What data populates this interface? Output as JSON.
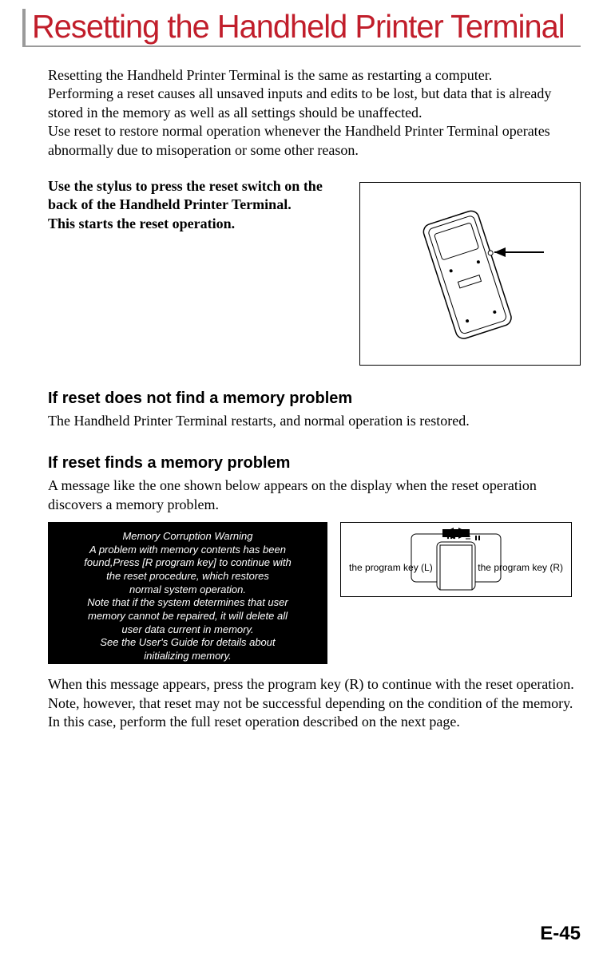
{
  "title": "Resetting the Handheld Printer Terminal",
  "intro": {
    "p1": "Resetting the Handheld Printer Terminal is the same as restarting a computer.",
    "p2": "Performing a reset causes all unsaved inputs and edits to be lost, but data that is already stored in the memory as well as all settings should be unaffected.",
    "p3": "Use reset to restore normal operation whenever the Handheld Printer Terminal operates abnormally due to misoperation or some other reason."
  },
  "instruction": {
    "l1": "Use the stylus to press the reset switch on the back of the Handheld Printer Terminal.",
    "l2": "This starts the reset operation."
  },
  "sec_no_problem": {
    "heading": "If reset does not find a memory problem",
    "body": "The Handheld Printer Terminal restarts, and normal operation is restored."
  },
  "sec_problem": {
    "heading": "If reset finds a memory problem",
    "body": "A message like the one shown below appears on the display when the reset operation discovers a memory problem."
  },
  "screenshot": {
    "l1": "Memory Corruption Warning",
    "l2": "A problem with memory contents has been",
    "l3": "found,Press [R program key] to continue with",
    "l4": "the reset procedure, which restores",
    "l5": "normal system operation.",
    "l6": "Note that if the system determines that user",
    "l7": "memory cannot be repaired, it will delete all",
    "l8": "user data current in memory.",
    "l9": "See the User's Guide for details about",
    "l10": "initializing memory."
  },
  "key_labels": {
    "left": "the program key (L)",
    "right": "the program key (R)"
  },
  "closing": "When this message appears, press the program key (R) to continue with the reset operation.  Note, however, that reset may not be successful depending on the condition of the memory.  In this case, perform the full reset operation described on the next page.",
  "page_number": "E-45"
}
